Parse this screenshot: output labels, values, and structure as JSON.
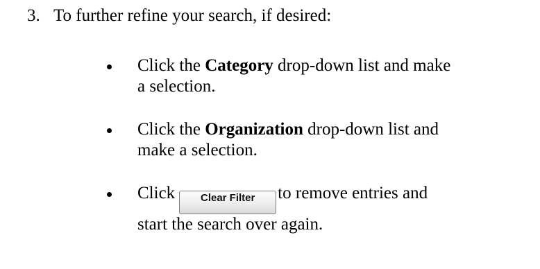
{
  "step": {
    "number": "3.",
    "text": "To further refine your search, if desired:"
  },
  "bullets": [
    {
      "prefix": "Click the ",
      "bold": "Category",
      "suffix_line1": " drop-down list and make",
      "suffix_line2": "a selection."
    },
    {
      "prefix": "Click the ",
      "bold": "Organization",
      "suffix_line1": " drop-down list and",
      "suffix_line2": "make a selection."
    },
    {
      "prefix": "Click",
      "button_label": "Clear Filter",
      "suffix_line1": "to remove entries and",
      "suffix_line2": "start the search over again."
    }
  ]
}
